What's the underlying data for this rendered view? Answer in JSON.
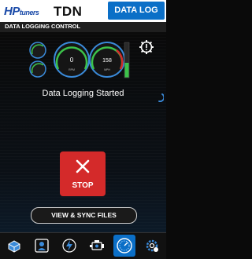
{
  "header": {
    "logo_brand": "HP",
    "logo_sub": "tuners",
    "partner_logo": "TDN",
    "title": "DATA LOG"
  },
  "subheader": {
    "title": "DATA LOGGING CONTROL"
  },
  "gauges": {
    "center_value": "0",
    "center_unit": "RPM",
    "right_value": "158",
    "right_unit": "MPH"
  },
  "status": {
    "message": "Data Logging Started"
  },
  "controls": {
    "stop_label": "STOP",
    "sync_label": "VIEW & SYNC FILES"
  },
  "tabs": [
    {
      "icon": "vehicle-icon",
      "active": false
    },
    {
      "icon": "profile-icon",
      "active": false
    },
    {
      "icon": "tune-icon",
      "active": false
    },
    {
      "icon": "engine-icon",
      "active": false
    },
    {
      "icon": "gauge-icon",
      "active": true
    },
    {
      "icon": "settings-icon",
      "active": false
    }
  ],
  "colors": {
    "accent": "#0b6fc7",
    "stop": "#d42a2a",
    "gauge_green": "#3cc24a"
  }
}
